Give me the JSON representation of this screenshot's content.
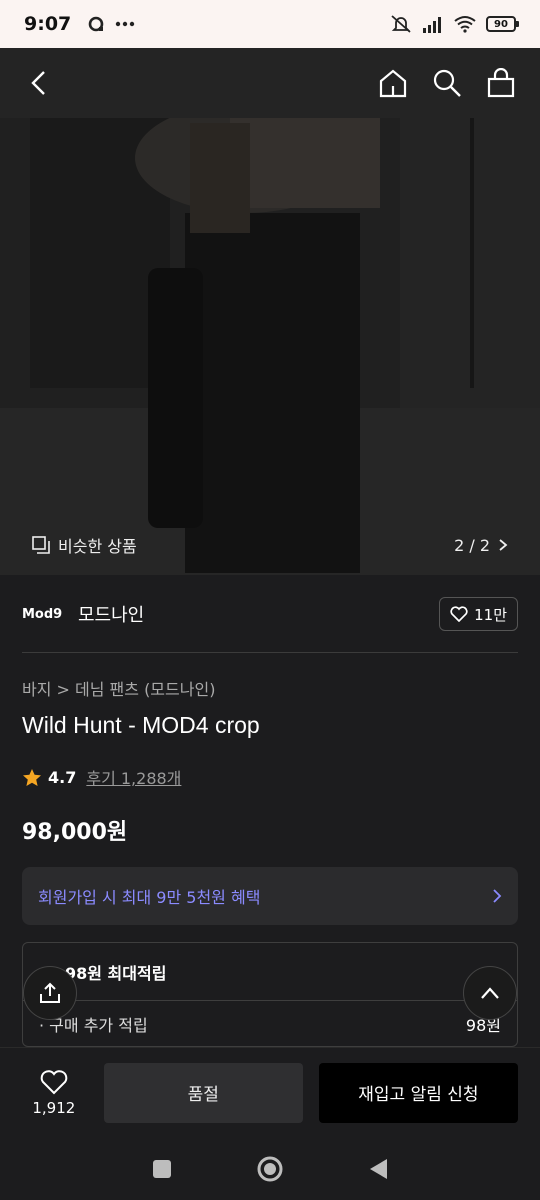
{
  "status_bar": {
    "time": "9:07",
    "battery": "90"
  },
  "header": {
    "icons": [
      "back-icon",
      "home-icon",
      "search-icon",
      "cart-icon"
    ]
  },
  "gallery": {
    "similar_label": "비슷한 상품",
    "pager": "2 / 2"
  },
  "brand": {
    "logo": "Mod9",
    "name": "모드나인",
    "likes": "11만"
  },
  "product": {
    "breadcrumb": "바지 > 데님 팬츠 (모드나인)",
    "title": "Wild Hunt - MOD4 crop",
    "rating": "4.7",
    "reviews": "후기 1,288개",
    "price": "98,000원"
  },
  "benefit": {
    "text": "회원가입 시 최대 9만 5천원 혜택"
  },
  "points": {
    "header": "98원 최대적립",
    "row_label": "· 구매 추가 적립",
    "row_value": "98원"
  },
  "bottom": {
    "wish_count": "1,912",
    "soldout_label": "품절",
    "restock_label": "재입고 알림 신청"
  },
  "colors": {
    "accent_text": "#8b8bff",
    "star": "#f5a623"
  }
}
